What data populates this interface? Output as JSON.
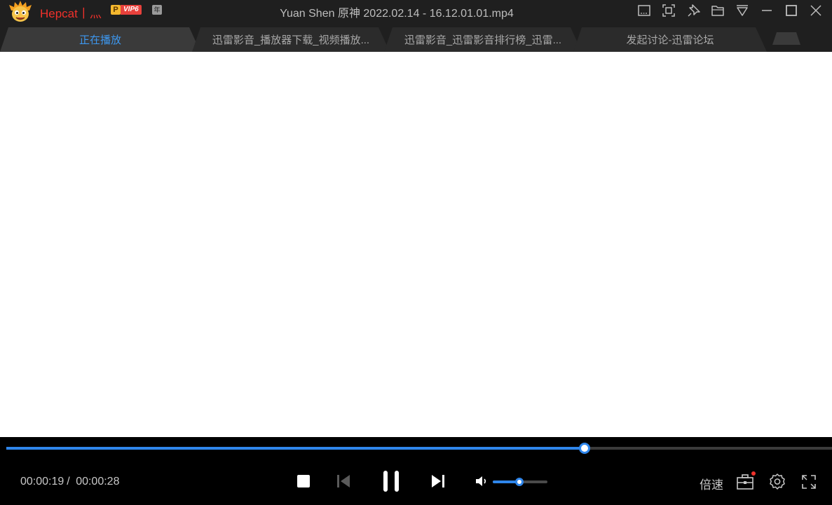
{
  "user": {
    "name": "Hepcat丨灬",
    "vip_letter": "P",
    "vip_label": "VIP6",
    "year_label": "年"
  },
  "window": {
    "title": "Yuan Shen 原神 2022.02.14 - 16.12.01.01.mp4"
  },
  "tabs": [
    {
      "label": "正在播放",
      "active": true
    },
    {
      "label": "迅雷影音_播放器下载_视频播放...",
      "active": false
    },
    {
      "label": "迅雷影音_迅雷影音排行榜_迅雷...",
      "active": false
    },
    {
      "label": "发起讨论-迅雷论坛",
      "active": false
    }
  ],
  "player": {
    "current_time": "00:00:19",
    "separator": "/",
    "total_time": "00:00:28",
    "progress": 0.7
  },
  "volume": {
    "level": 0.49
  },
  "controls": {
    "speed_label": "倍速"
  },
  "colors": {
    "accent": "#2f86eb",
    "username": "#f0312b",
    "active_tab": "#3d98f0"
  }
}
